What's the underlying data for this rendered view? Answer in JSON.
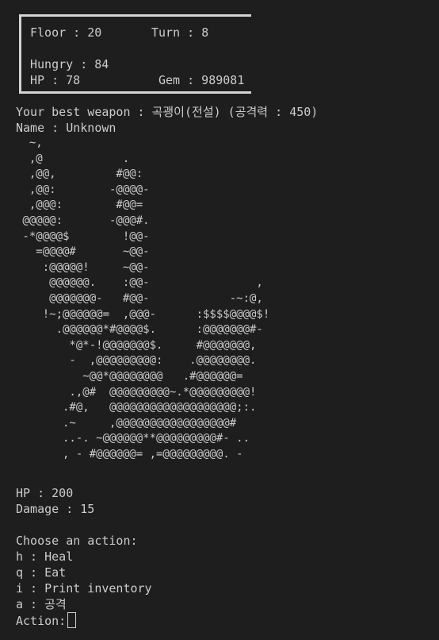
{
  "status": {
    "floor": "Floor : 20",
    "turn": "Turn : 8",
    "hungry": "Hungry : 84",
    "hp": "HP : 78",
    "gem": "Gem : 989081"
  },
  "weapon_line": "Your best weapon : 곡괭이(전설) (공격력 : 450)",
  "name_line": "Name : Unknown",
  "art": [
    "  ~,",
    "  ,@            .",
    "  ,@@,         #@@:",
    "  ,@@:        -@@@@-",
    "  ,@@@:        #@@=",
    " @@@@@:       -@@@#.",
    " -*@@@@$        !@@-",
    "   =@@@@#       ~@@-",
    "    :@@@@@!     ~@@-",
    "     @@@@@@.    :@@-                ,",
    "     @@@@@@@-   #@@-            -~:@,",
    "    !~;@@@@@@=  ,@@@-      :$$$$@@@@$!",
    "      .@@@@@@*#@@@@$.      :@@@@@@@#-",
    "        *@*-!@@@@@@@$.     #@@@@@@@,",
    "        -  ,@@@@@@@@@:    .@@@@@@@@.",
    "          ~@@*@@@@@@@@   .#@@@@@@=",
    "        .,@#  @@@@@@@@@~.*@@@@@@@@@!",
    "       .#@,   @@@@@@@@@@@@@@@@@@@;:.",
    "       .~     ,@@@@@@@@@@@@@@@@@#",
    "       ..-. ~@@@@@@**@@@@@@@@@#- ..",
    "       , - #@@@@@@= ,=@@@@@@@@@. -"
  ],
  "monster": {
    "hp": "HP : 200",
    "damage": "Damage : 15"
  },
  "prompt": {
    "title": "Choose an action:",
    "options": [
      "h : Heal",
      "q : Eat",
      "i : Print inventory",
      "a : 공격"
    ],
    "input_label": "Action:"
  }
}
